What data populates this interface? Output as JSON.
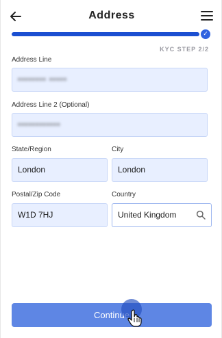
{
  "header": {
    "title": "Address"
  },
  "progress": {
    "fraction": 1.0,
    "step_label": "KYC STEP 2/2"
  },
  "form": {
    "address_line_label": "Address Line",
    "address_line_value": "•••••••• •••••",
    "address_line2_label": "Address Line 2 (Optional)",
    "address_line2_value": "••••••••••••",
    "state_label": "State/Region",
    "state_value": "London",
    "city_label": "City",
    "city_value": "London",
    "postal_label": "Postal/Zip Code",
    "postal_value": "W1D 7HJ",
    "country_label": "Country",
    "country_value": "United Kingdom"
  },
  "actions": {
    "continue_label": "Continue"
  },
  "colors": {
    "accent": "#1b4fd1",
    "field_bg": "#e8efff",
    "button": "#5e86e4"
  },
  "icons": [
    "back-arrow-icon",
    "hamburger-menu-icon",
    "check-icon",
    "search-icon",
    "hand-cursor-icon"
  ]
}
